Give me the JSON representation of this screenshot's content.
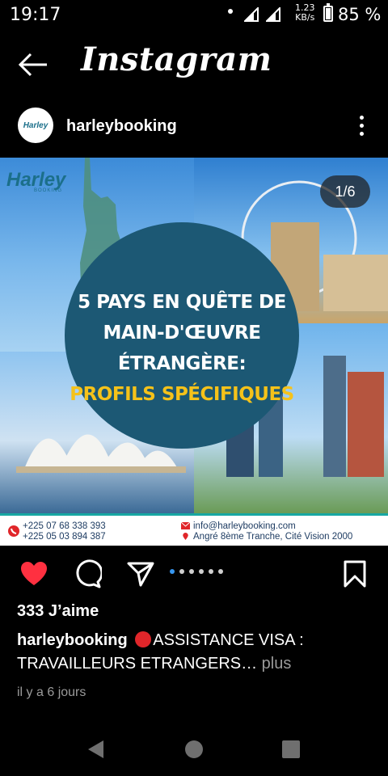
{
  "status_bar": {
    "time": "19:17",
    "speed_value": "1.23",
    "speed_unit": "KB/s",
    "battery": "85 %",
    "battery_level": 0.85
  },
  "app": {
    "title": "Instagram",
    "back_icon": "arrow-left-icon"
  },
  "post": {
    "username": "harleybooking",
    "avatar_text": "Harley",
    "more_icon": "more-vertical-icon",
    "image": {
      "counter": "1/6",
      "brand": "Harley",
      "brand_sub": "BOOKING",
      "headline_line1": "5 PAYS EN QUÊTE DE",
      "headline_line2": "MAIN-D'ŒUVRE ÉTRANGÈRE:",
      "headline_line3": "PROFILS SPÉCIFIQUES",
      "phone1": "+225 07 68 338 393",
      "phone2": "+225 05 03 894 387",
      "email": "info@harleybooking.com",
      "address": "Angré 8ème Tranche, Cité Vision 2000",
      "accent_color": "#f5c21a",
      "circle_color": "#1c5874"
    },
    "actions": {
      "like_icon": "heart-filled-icon",
      "comment_icon": "comment-icon",
      "share_icon": "send-icon",
      "save_icon": "bookmark-icon",
      "like_color": "#ff3040"
    },
    "carousel_dots": 6,
    "carousel_active": 1,
    "likes": "333 J’aime",
    "caption": {
      "user": "harleybooking",
      "text_part1": "ASSISTANCE VISA :",
      "text_part2": "TRAVAILLEURS ETRANGERS",
      "ellipsis": "…",
      "more": "plus"
    },
    "timestamp": "il y a 6 jours"
  },
  "nav": {
    "back_icon": "triangle-back-icon",
    "home_icon": "circle-home-icon",
    "recents_icon": "square-recents-icon"
  }
}
